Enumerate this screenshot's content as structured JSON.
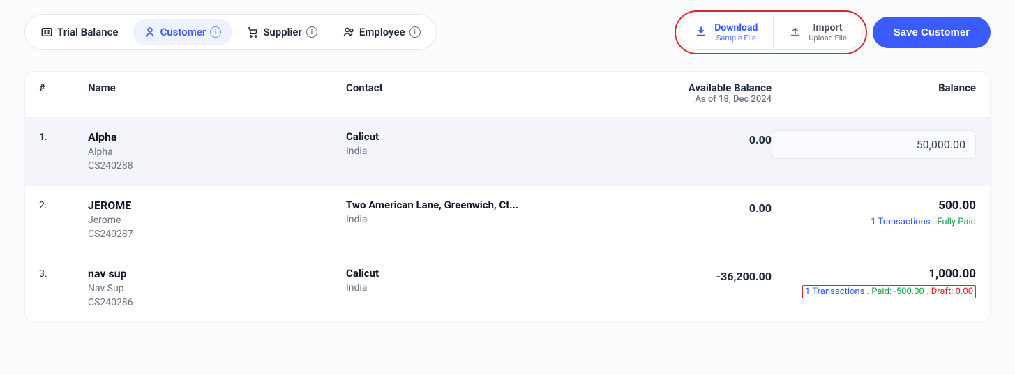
{
  "tabs": {
    "trial_balance": "Trial Balance",
    "customer": "Customer",
    "supplier": "Supplier",
    "employee": "Employee"
  },
  "actions": {
    "download": {
      "title": "Download",
      "sub": "Sample File"
    },
    "import": {
      "title": "Import",
      "sub": "Upload File"
    },
    "save": "Save Customer"
  },
  "table": {
    "headers": {
      "index": "#",
      "name": "Name",
      "contact": "Contact",
      "available": "Available Balance",
      "available_sub": "As of 18, Dec 2024",
      "balance": "Balance"
    },
    "rows": [
      {
        "index": "1.",
        "name": "Alpha",
        "secondary": "Alpha",
        "code": "CS240288",
        "contact_location": "Calicut",
        "contact_country": "India",
        "available": "0.00",
        "balance_input": "50,000.00",
        "status": null
      },
      {
        "index": "2.",
        "name": "JEROME",
        "secondary": "Jerome",
        "code": "CS240287",
        "contact_location": "Two American Lane, Greenwich, Ct...",
        "contact_country": "India",
        "available": "0.00",
        "balance_amount": "500.00",
        "status": {
          "transactions": "1 Transactions",
          "dot": ".",
          "paid_label": "Fully Paid"
        }
      },
      {
        "index": "3.",
        "name": "nav sup",
        "secondary": "Nav Sup",
        "code": "CS240286",
        "contact_location": "Calicut",
        "contact_country": "India",
        "available": "-36,200.00",
        "balance_amount": "1,000.00",
        "status": {
          "transactions": "1 Transactions",
          "dot1": ".",
          "paid": "Paid: -500.00",
          "dot2": ".",
          "draft": "Draft: 0.00"
        }
      }
    ]
  }
}
